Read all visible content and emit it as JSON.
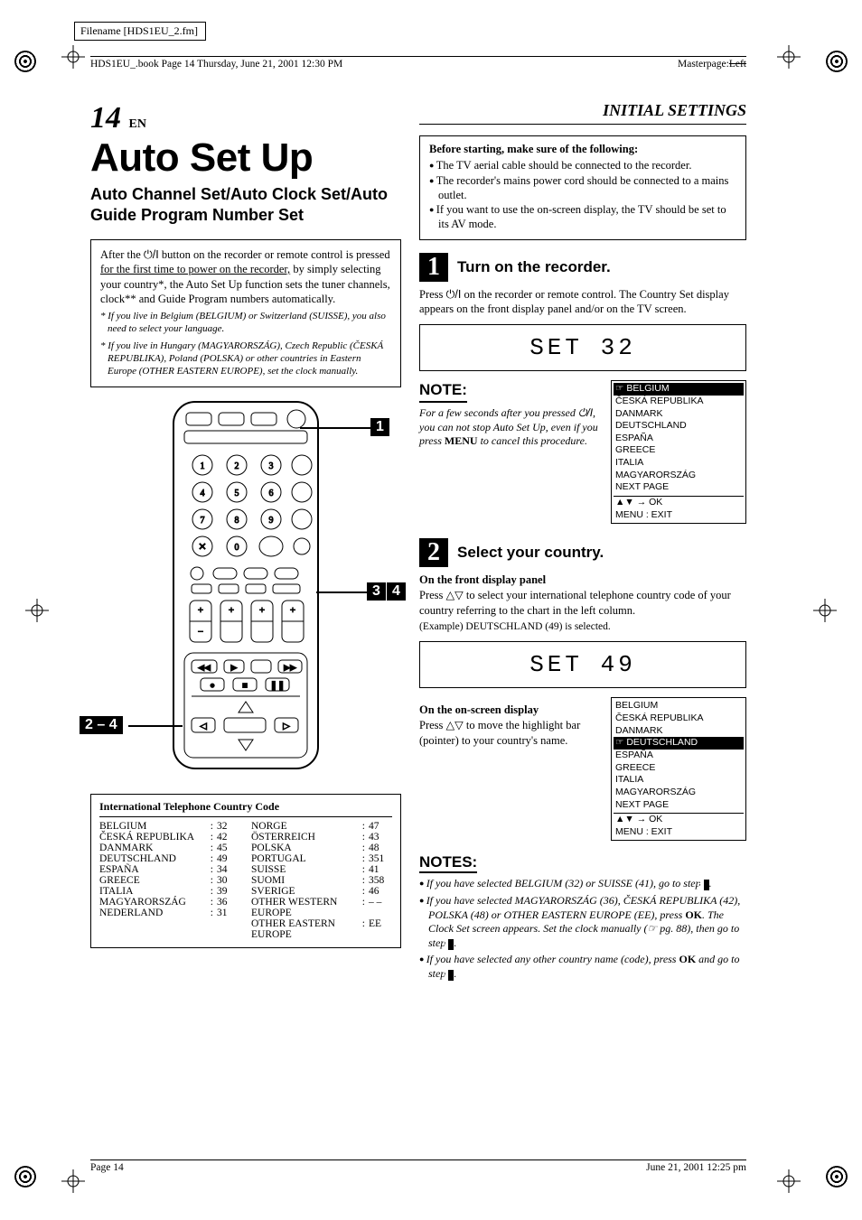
{
  "meta": {
    "filename_label": "Filename [HDS1EU_2.fm]",
    "bookline": "HDS1EU_.book  Page 14  Thursday, June 21, 2001  12:30 PM",
    "masterpage_label": "Masterpage:",
    "masterpage_value": "Left",
    "footer_left": "Page 14",
    "footer_right": "June 21, 2001  12:25 pm"
  },
  "header": {
    "page_number": "14",
    "page_suffix": "EN",
    "section": "INITIAL SETTINGS"
  },
  "title": "Auto Set Up",
  "subtitle": "Auto Channel Set/Auto Clock Set/Auto Guide Program Number Set",
  "intro": {
    "body_pre": "After the ",
    "body_mid1": " button on the recorder or remote control is pressed ",
    "body_underlined": "for the first time to power on the recorder,",
    "body_post": " by simply selecting your country*, the Auto Set Up function sets the tuner channels, clock** and Guide Program numbers automatically.",
    "foot1": "* If you live in Belgium (BELGIUM) or Switzerland (SUISSE), you also need to select your language.",
    "foot2": "* If you live in Hungary (MAGYARORSZÁG), Czech Republic (ČESKÁ REPUBLIKA), Poland (POLSKA) or other countries in Eastern Europe (OTHER EASTERN EUROPE), set the clock manually."
  },
  "remote_callouts": {
    "top_right": "1",
    "mid_pair_a": "3",
    "mid_pair_b": "4",
    "bottom_left": "2 – 4"
  },
  "country_table": {
    "title": "International Telephone Country Code",
    "left": [
      {
        "name": "BELGIUM",
        "code": "32"
      },
      {
        "name": "ČESKÁ REPUBLIKA",
        "code": "42"
      },
      {
        "name": "DANMARK",
        "code": "45"
      },
      {
        "name": "DEUTSCHLAND",
        "code": "49"
      },
      {
        "name": "ESPAÑA",
        "code": "34"
      },
      {
        "name": "GREECE",
        "code": "30"
      },
      {
        "name": "ITALIA",
        "code": "39"
      },
      {
        "name": "MAGYARORSZÁG",
        "code": "36"
      },
      {
        "name": "NEDERLAND",
        "code": "31"
      }
    ],
    "right": [
      {
        "name": "NORGE",
        "code": "47"
      },
      {
        "name": "ÖSTERREICH",
        "code": "43"
      },
      {
        "name": "POLSKA",
        "code": "48"
      },
      {
        "name": "PORTUGAL",
        "code": "351"
      },
      {
        "name": "SUISSE",
        "code": "41"
      },
      {
        "name": "SUOMI",
        "code": "358"
      },
      {
        "name": "SVERIGE",
        "code": "46"
      },
      {
        "name": "OTHER WESTERN EUROPE",
        "code": "– –"
      },
      {
        "name": "OTHER EASTERN EUROPE",
        "code": "EE"
      }
    ]
  },
  "before_box": {
    "title": "Before starting, make sure of the following:",
    "items": [
      "The TV aerial cable should be connected to the recorder.",
      "The recorder's mains power cord should be connected to a mains outlet.",
      "If you want to use the on-screen display, the TV should be set to its AV mode."
    ]
  },
  "step1": {
    "num": "1",
    "title": "Turn on the recorder.",
    "body_pre": "Press ",
    "body_post": " on the recorder or remote control. The Country Set display appears on the front display panel and/or on the TV screen.",
    "display": "SET 32",
    "note_label": "NOTE:",
    "note_body_pre": "For a few seconds after you pressed ",
    "note_body_mid": ", you can not stop Auto Set Up, even if you press ",
    "note_body_key": "MENU",
    "note_body_post": " to cancel this procedure.",
    "osd": {
      "items": [
        "BELGIUM",
        "ČESKÁ REPUBLIKA",
        "DANMARK",
        "DEUTSCHLAND",
        "ESPAÑA",
        "GREECE",
        "ITALIA",
        "MAGYARORSZÁG",
        "NEXT PAGE"
      ],
      "highlight_index": 0,
      "footer1": "▲▼ → OK",
      "footer2": "MENU : EXIT"
    }
  },
  "step2": {
    "num": "2",
    "title": "Select your country.",
    "panel_heading": "On the front display panel",
    "panel_body": "Press △▽ to select your international telephone country code of your country referring to the chart in the left column.",
    "panel_example": "(Example) DEUTSCHLAND (49) is selected.",
    "display": "SET 49",
    "osd_heading": "On the on-screen display",
    "osd_body": "Press △▽ to move the highlight bar (pointer) to your country's name.",
    "osd": {
      "items": [
        "BELGIUM",
        "ČESKÁ REPUBLIKA",
        "DANMARK",
        "DEUTSCHLAND",
        "ESPAÑA",
        "GREECE",
        "ITALIA",
        "MAGYARORSZÁG",
        "NEXT PAGE"
      ],
      "highlight_index": 3,
      "footer1": "▲▼ → OK",
      "footer2": "MENU : EXIT"
    }
  },
  "notes": {
    "label": "NOTES:",
    "items": [
      {
        "pre": "If you have selected BELGIUM (32) or SUISSE (41), go to step ",
        "blk": "3",
        "post": "."
      },
      {
        "pre": "If you have selected MAGYARORSZÁG (36), ČESKÁ REPUBLIKA (42), POLSKA (48) or OTHER EASTERN EUROPE (EE), press ",
        "key": "OK",
        "mid": ". The Clock Set screen appears. Set the clock manually (☞ pg. 88), then go to step ",
        "blk": "4",
        "post": "."
      },
      {
        "pre": "If you have selected any other country name (code), press ",
        "key": "OK",
        "mid": " and go to step ",
        "blk": "4",
        "post": "."
      }
    ]
  }
}
